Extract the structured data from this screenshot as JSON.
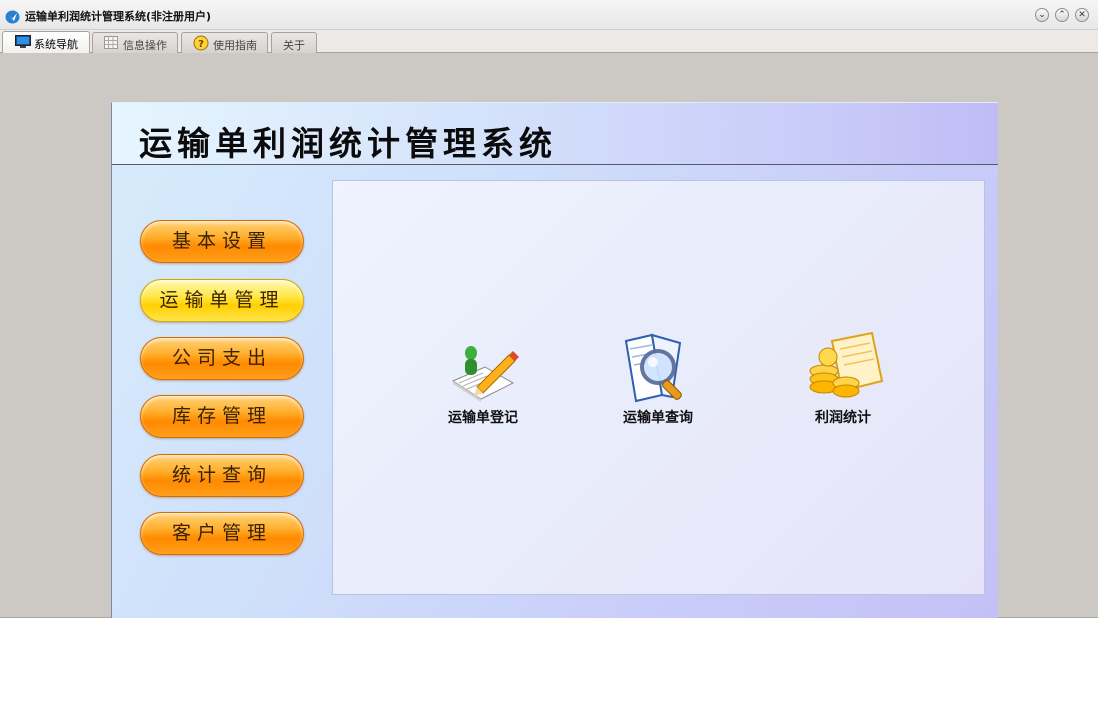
{
  "window": {
    "title": "运输单利润统计管理系统(非注册用户)"
  },
  "tabs": [
    {
      "label": "系统导航",
      "icon": "monitor-icon",
      "active": true
    },
    {
      "label": "信息操作",
      "icon": "grid-icon",
      "active": false
    },
    {
      "label": "使用指南",
      "icon": "help-icon",
      "active": false
    },
    {
      "label": "关于",
      "icon": "",
      "active": false
    }
  ],
  "header": {
    "title": "运输单利润统计管理系统"
  },
  "menu": [
    {
      "label": "基本设置"
    },
    {
      "label": "运输单管理"
    },
    {
      "label": "公司支出"
    },
    {
      "label": "库存管理"
    },
    {
      "label": "统计查询"
    },
    {
      "label": "客户管理"
    }
  ],
  "features": [
    {
      "label": "运输单登记",
      "icon": "register-pen-icon"
    },
    {
      "label": "运输单查询",
      "icon": "magnifier-book-icon"
    },
    {
      "label": "利润统计",
      "icon": "coins-icon"
    }
  ],
  "colors": {
    "menu_button": "#ff9a12",
    "menu_button_selected": "#ffe14a",
    "panel_bg": "#cfdcfb"
  }
}
